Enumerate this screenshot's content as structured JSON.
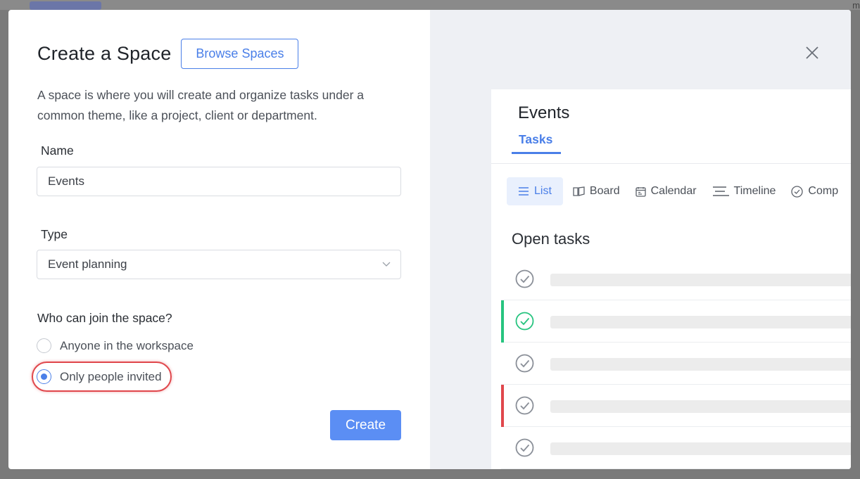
{
  "backdrop": {
    "right_text": "m"
  },
  "dialog": {
    "title": "Create a Space",
    "browse_label": "Browse Spaces",
    "description": "A space is where you will create and organize tasks under a common theme, like a project, client or department.",
    "name_label": "Name",
    "name_value": "Events",
    "type_label": "Type",
    "type_value": "Event planning",
    "join_question": "Who can join the space?",
    "join_options": [
      {
        "label": "Anyone in the workspace",
        "selected": false
      },
      {
        "label": "Only people invited",
        "selected": true
      }
    ],
    "create_label": "Create"
  },
  "preview": {
    "space_name": "Events",
    "tab_label": "Tasks",
    "views": [
      {
        "label": "List",
        "icon": "list-icon",
        "active": true
      },
      {
        "label": "Board",
        "icon": "board-icon",
        "active": false
      },
      {
        "label": "Calendar",
        "icon": "calendar-icon",
        "active": false
      },
      {
        "label": "Timeline",
        "icon": "timeline-icon",
        "active": false
      },
      {
        "label": "Comp",
        "icon": "check-circle-icon",
        "active": false
      }
    ],
    "section_title": "Open tasks",
    "tasks": [
      {
        "status_color": "",
        "check_color": "#8a8f98"
      },
      {
        "status_color": "#27c47f",
        "check_color": "#27c47f"
      },
      {
        "status_color": "",
        "check_color": "#8a8f98"
      },
      {
        "status_color": "#e0474c",
        "check_color": "#8a8f98"
      },
      {
        "status_color": "",
        "check_color": "#8a8f98"
      }
    ]
  },
  "colors": {
    "accent": "#4a7fe8",
    "create_button": "#5b8ef4",
    "highlight": "#e0474c"
  }
}
